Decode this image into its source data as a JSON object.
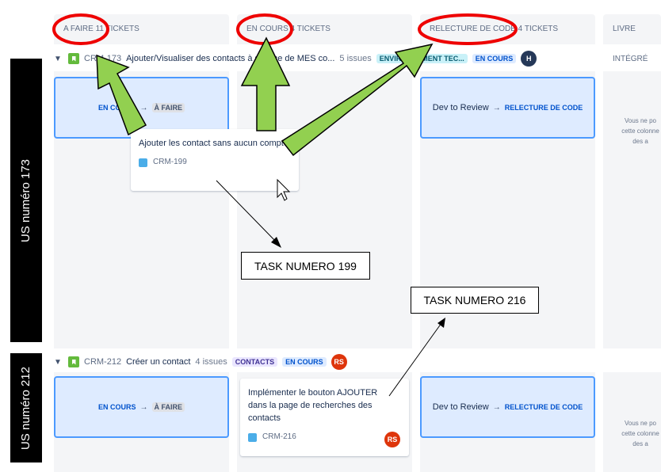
{
  "columns": [
    {
      "label": "A FAIRE 11 TICKETS"
    },
    {
      "label": "EN COURS 4 TICKETS"
    },
    {
      "label": "RELECTURE DE CODE 4 TICKETS"
    },
    {
      "label": "LIVRE INTÉGRÉ"
    }
  ],
  "swimlanes": [
    {
      "key": "CRM-173",
      "summary": "Ajouter/Visualiser des contacts à service de MES co...",
      "issues": "5 issues",
      "tag": "ENVIRONNEMENT TEC...",
      "status": "EN COURS",
      "avatar": "H",
      "avatar_color": "#253858",
      "todo_transition": {
        "from": "EN COURS",
        "to": "À FAIRE"
      },
      "review_transition": {
        "from": "Dev to Review",
        "to": "RELECTURE DE CODE"
      },
      "drop_note": [
        "Vous ne po",
        "cette colonne",
        "des a"
      ]
    },
    {
      "key": "CRM-212",
      "summary": "Créer un contact",
      "issues": "4 issues",
      "tag": "CONTACTS",
      "status": "EN COURS",
      "avatar": "RS",
      "avatar_color": "#de350b",
      "todo_transition": {
        "from": "EN COURS",
        "to": "À FAIRE"
      },
      "review_transition": {
        "from": "Dev to Review",
        "to": "RELECTURE DE CODE"
      },
      "drop_note": [
        "Vous ne po",
        "cette colonne",
        "des a"
      ]
    }
  ],
  "cards": [
    {
      "summary": "Ajouter les contact sans aucun compte",
      "key": "CRM-199"
    },
    {
      "summary": "Implémenter le bouton AJOUTER dans la page de recherches des contacts",
      "key": "CRM-216",
      "avatar": "RS"
    }
  ],
  "annotations": {
    "label_us173": "US numéro 173",
    "label_us212": "US numéro 212",
    "task199": "TASK NUMERO 199",
    "task216": "TASK NUMERO 216"
  },
  "colors": {
    "highlight_ellipse": "#ee0000",
    "arrow_fill": "#92d050",
    "arrow_stroke": "#000000",
    "transition_bg": "#deebff",
    "transition_border": "#4c9aff"
  }
}
